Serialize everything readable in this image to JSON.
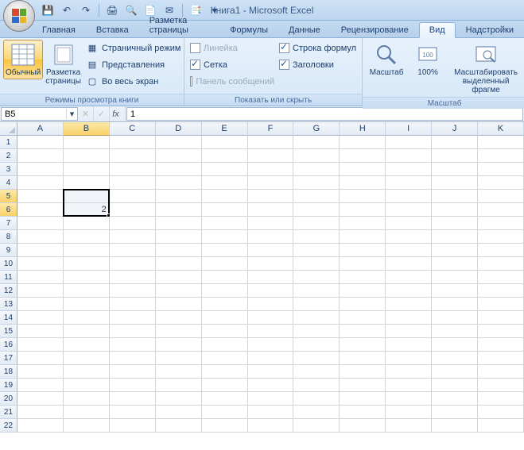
{
  "app": {
    "title": "Книга1 - Microsoft Excel"
  },
  "qat": {
    "save": "💾",
    "undo": "↶",
    "redo": "↷",
    "q1": "🖨",
    "q2": "🔍",
    "q3": "📄",
    "q4": "✉",
    "q5": "📑"
  },
  "tabs": [
    "Главная",
    "Вставка",
    "Разметка страницы",
    "Формулы",
    "Данные",
    "Рецензирование",
    "Вид",
    "Надстройки"
  ],
  "activeTab": 6,
  "ribbon": {
    "group1": {
      "caption": "Режимы просмотра книги",
      "normal": "Обычный",
      "pageLayout": "Разметка\nстраницы",
      "pageBreak": "Страничный режим",
      "customViews": "Представления",
      "fullScreen": "Во весь экран"
    },
    "group2": {
      "caption": "Показать или скрыть",
      "ruler": "Линейка",
      "grid": "Сетка",
      "messagePanel": "Панель сообщений",
      "formulaBar": "Строка формул",
      "headings": "Заголовки"
    },
    "group3": {
      "caption": "Масштаб",
      "zoom": "Масштаб",
      "z100": "100%",
      "zoomSel": "Масштабировать\nвыделенный фрагме"
    }
  },
  "namebox": "B5",
  "formula": "1",
  "columns": [
    "A",
    "B",
    "C",
    "D",
    "E",
    "F",
    "G",
    "H",
    "I",
    "J",
    "K"
  ],
  "rowCount": 22,
  "cells": {
    "B5": "1",
    "B6": "2"
  },
  "selection": {
    "col": 1,
    "row": 4,
    "cols": 1,
    "rows": 2,
    "activeRow": 4
  },
  "chart_data": null
}
